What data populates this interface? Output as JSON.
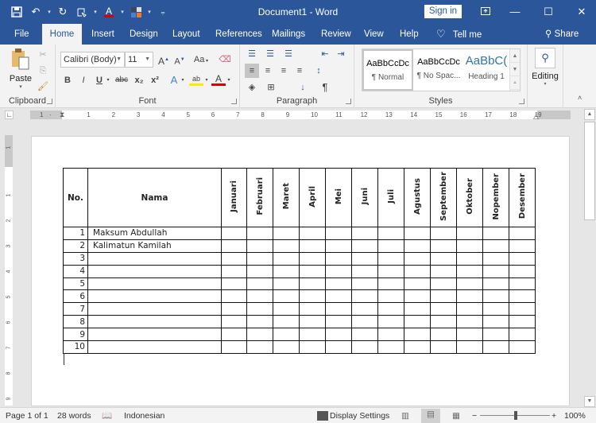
{
  "titlebar": {
    "title": "Document1  -  Word",
    "sign_in": "Sign in",
    "minimize": "—",
    "maximize": "☐",
    "close": "✕",
    "ribbon_display": "⧉"
  },
  "qat": {
    "save": "🖫",
    "undo": "↶",
    "redo": "↻",
    "touch": "☜",
    "font_color": "A",
    "shading": "▚",
    "customize": "⩦"
  },
  "tabs": [
    "File",
    "Home",
    "Insert",
    "Design",
    "Layout",
    "References",
    "Mailings",
    "Review",
    "View",
    "Help"
  ],
  "tell_me": "Tell me",
  "share": "Share",
  "ribbon": {
    "clipboard": {
      "label": "Clipboard",
      "paste": "Paste"
    },
    "font": {
      "label": "Font",
      "font_name": "Calibri (Body)",
      "font_size": "11",
      "bold": "B",
      "italic": "I",
      "underline": "U",
      "strike": "abc",
      "sub": "x₂",
      "sup": "x²",
      "grow": "A˄",
      "shrink": "A˅",
      "case": "Aa",
      "clear": "✎",
      "effects": "A",
      "highlight": "ab",
      "color": "A"
    },
    "paragraph": {
      "label": "Paragraph",
      "pilcrow": "¶"
    },
    "styles": {
      "label": "Styles",
      "items": [
        {
          "preview": "AaBbCcDc",
          "name": "¶ Normal"
        },
        {
          "preview": "AaBbCcDc",
          "name": "¶ No Spac..."
        },
        {
          "preview": "AaBbC(",
          "name": "Heading 1"
        }
      ]
    },
    "editing": {
      "label": "Editing"
    }
  },
  "ruler": {
    "h_ticks": [
      "1",
      "·",
      "1",
      "2",
      "3",
      "4",
      "5",
      "6",
      "7",
      "8",
      "9",
      "10",
      "11",
      "12",
      "13",
      "14",
      "15",
      "16",
      "17",
      "18",
      "19"
    ],
    "v_ticks": [
      "1",
      "1",
      "2",
      "3",
      "4",
      "5",
      "6",
      "7",
      "8",
      "9"
    ]
  },
  "table": {
    "headers": {
      "no": "No.",
      "nama": "Nama"
    },
    "months": [
      "Januari",
      "Februari",
      "Maret",
      "April",
      "Mei",
      "Juni",
      "Juli",
      "Agustus",
      "September",
      "Oktober",
      "Nopember",
      "Desember"
    ],
    "rows": [
      {
        "no": "1",
        "nama": "Maksum Abdullah"
      },
      {
        "no": "2",
        "nama": "Kalimatun Kamilah"
      },
      {
        "no": "3",
        "nama": ""
      },
      {
        "no": "4",
        "nama": ""
      },
      {
        "no": "5",
        "nama": ""
      },
      {
        "no": "6",
        "nama": ""
      },
      {
        "no": "7",
        "nama": ""
      },
      {
        "no": "8",
        "nama": ""
      },
      {
        "no": "9",
        "nama": ""
      },
      {
        "no": "10",
        "nama": ""
      }
    ]
  },
  "status": {
    "page": "Page 1 of 1",
    "words": "28 words",
    "language": "Indonesian",
    "display_settings": "Display Settings",
    "zoom_minus": "−",
    "zoom_plus": "+",
    "zoom": "100%"
  }
}
